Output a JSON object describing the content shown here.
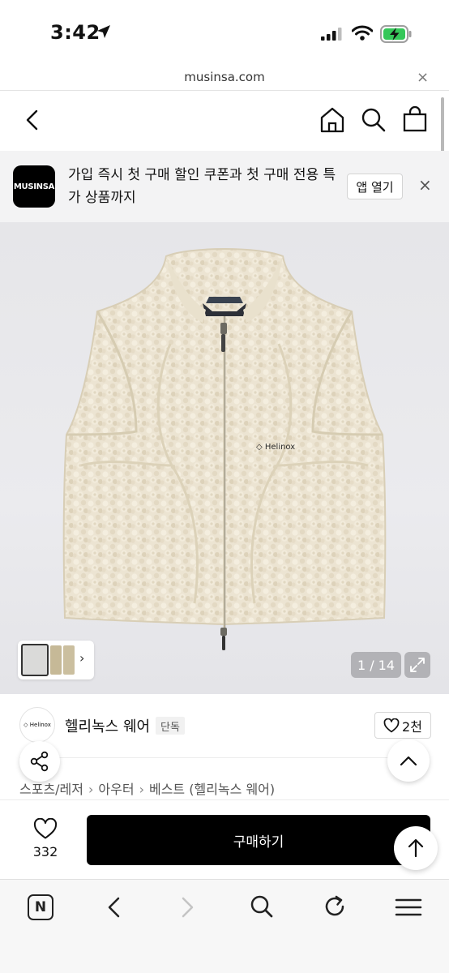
{
  "status_bar": {
    "time": "3:42"
  },
  "url_bar": {
    "url": "musinsa.com",
    "close": "×"
  },
  "app_banner": {
    "logo_text": "MUSINSA",
    "message": "가입 즉시 첫 구매 할인 쿠폰과 첫 구매 전용 특가 상품까지",
    "open_app_label": "앱 열기",
    "close": "×"
  },
  "gallery": {
    "counter": "1 / 14",
    "thumb_next": "›"
  },
  "brand": {
    "logo_text": "◇ Helinox",
    "name": "헬리녹스 웨어",
    "badge": "단독",
    "likes": "2천"
  },
  "breadcrumb": [
    "스포츠/레저",
    "아우터",
    "베스트 (헬리녹스 웨어)"
  ],
  "buy_bar": {
    "wish_count": "332",
    "buy_label": "구매하기"
  },
  "product_print": "◇ Helinox"
}
